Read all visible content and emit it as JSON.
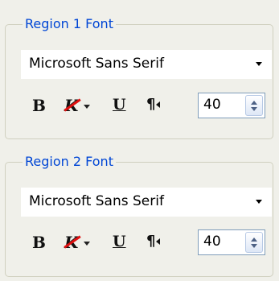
{
  "region1": {
    "title": "Region 1 Font",
    "font_name": "Microsoft Sans Serif",
    "toolbar": {
      "bold": "B",
      "font_color": "K",
      "underline": "U",
      "paragraph": "¶"
    },
    "size": "40"
  },
  "region2": {
    "title": "Region 2 Font",
    "font_name": "Microsoft Sans Serif",
    "toolbar": {
      "bold": "B",
      "font_color": "K",
      "underline": "U",
      "paragraph": "¶"
    },
    "size": "40"
  },
  "colors": {
    "legend": "#0046d5",
    "background": "#f0f0ea",
    "font_color_strike": "#e01010"
  },
  "icons": [
    "bold-icon",
    "font-color-icon",
    "underline-icon",
    "paragraph-direction-icon",
    "spinner-up-icon",
    "spinner-down-icon"
  ]
}
